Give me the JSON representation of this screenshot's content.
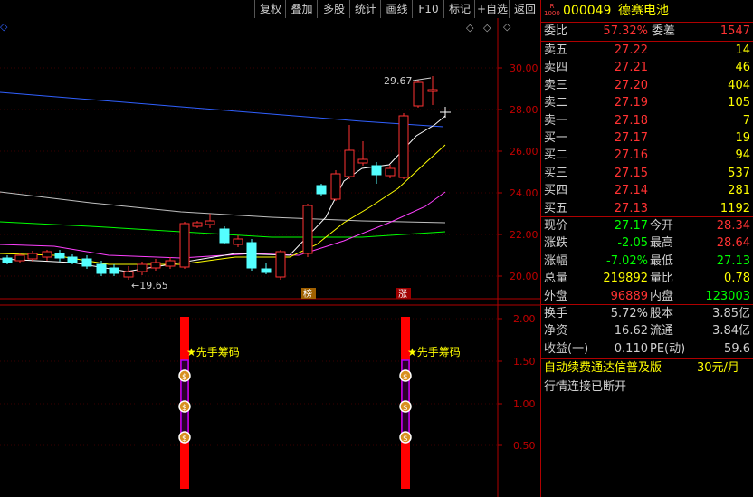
{
  "toolbar": {
    "items": [
      "复权",
      "叠加",
      "多股",
      "统计",
      "画线",
      "F10",
      "标记",
      "+自选",
      "返回"
    ]
  },
  "stock": {
    "badge_top": "R",
    "badge_bottom": "1000",
    "code": "000049",
    "name": "德赛电池"
  },
  "chart": {
    "high_label": "29.67",
    "low_label": "←19.65",
    "price_ticks": [
      "30.00",
      "28.00",
      "26.00",
      "24.00",
      "22.00",
      "20.00"
    ],
    "marker_bang": "榜",
    "marker_zhang": "涨",
    "indicator_ticks": [
      "2.00",
      "1.50",
      "1.00",
      "0.50"
    ],
    "signal_label": "★先手筹码",
    "money_icon_glyph": "$",
    "colors": {
      "up": "#ff3232",
      "down": "#54ffff",
      "ma5": "#ffffff",
      "ma10": "#ffff00",
      "ma20": "#ff40ff",
      "ma60": "#00ff00",
      "ma120": "#c0c0c0",
      "ma250": "#3060ff",
      "axis": "#b00000"
    }
  },
  "order_book": {
    "ratio_label": "委比",
    "ratio_value": "57.32%",
    "diff_label": "委差",
    "diff_value": "1547",
    "sells": [
      {
        "label": "卖五",
        "price": "27.22",
        "vol": "14"
      },
      {
        "label": "卖四",
        "price": "27.21",
        "vol": "46"
      },
      {
        "label": "卖三",
        "price": "27.20",
        "vol": "404"
      },
      {
        "label": "卖二",
        "price": "27.19",
        "vol": "105"
      },
      {
        "label": "卖一",
        "price": "27.18",
        "vol": "7"
      }
    ],
    "buys": [
      {
        "label": "买一",
        "price": "27.17",
        "vol": "19"
      },
      {
        "label": "买二",
        "price": "27.16",
        "vol": "94"
      },
      {
        "label": "买三",
        "price": "27.15",
        "vol": "537"
      },
      {
        "label": "买四",
        "price": "27.14",
        "vol": "281"
      },
      {
        "label": "买五",
        "price": "27.13",
        "vol": "1192"
      }
    ]
  },
  "quote": {
    "rows": [
      {
        "l1": "现价",
        "v1": "27.17",
        "l2": "今开",
        "v2": "28.34"
      },
      {
        "l1": "涨跌",
        "v1": "-2.05",
        "l2": "最高",
        "v2": "28.64"
      },
      {
        "l1": "涨幅",
        "v1": "-7.02%",
        "l2": "最低",
        "v2": "27.13"
      },
      {
        "l1": "总量",
        "v1": "219892",
        "l2": "量比",
        "v2": "0.78"
      },
      {
        "l1": "外盘",
        "v1": "96889",
        "l2": "内盘",
        "v2": "123003"
      }
    ]
  },
  "fundamentals": {
    "rows": [
      {
        "l1": "换手",
        "v1": "5.72%",
        "l2": "股本",
        "v2": "3.85亿"
      },
      {
        "l1": "净资",
        "v1": "16.62",
        "l2": "流通",
        "v2": "3.84亿"
      },
      {
        "l1": "收益(一)",
        "v1": "0.110",
        "l2": "PE(动)",
        "v2": "59.6"
      }
    ]
  },
  "footer": {
    "ad_text": "自动续费通达信普及版",
    "ad_price": "30元/月",
    "status": "行情连接已断开"
  }
}
